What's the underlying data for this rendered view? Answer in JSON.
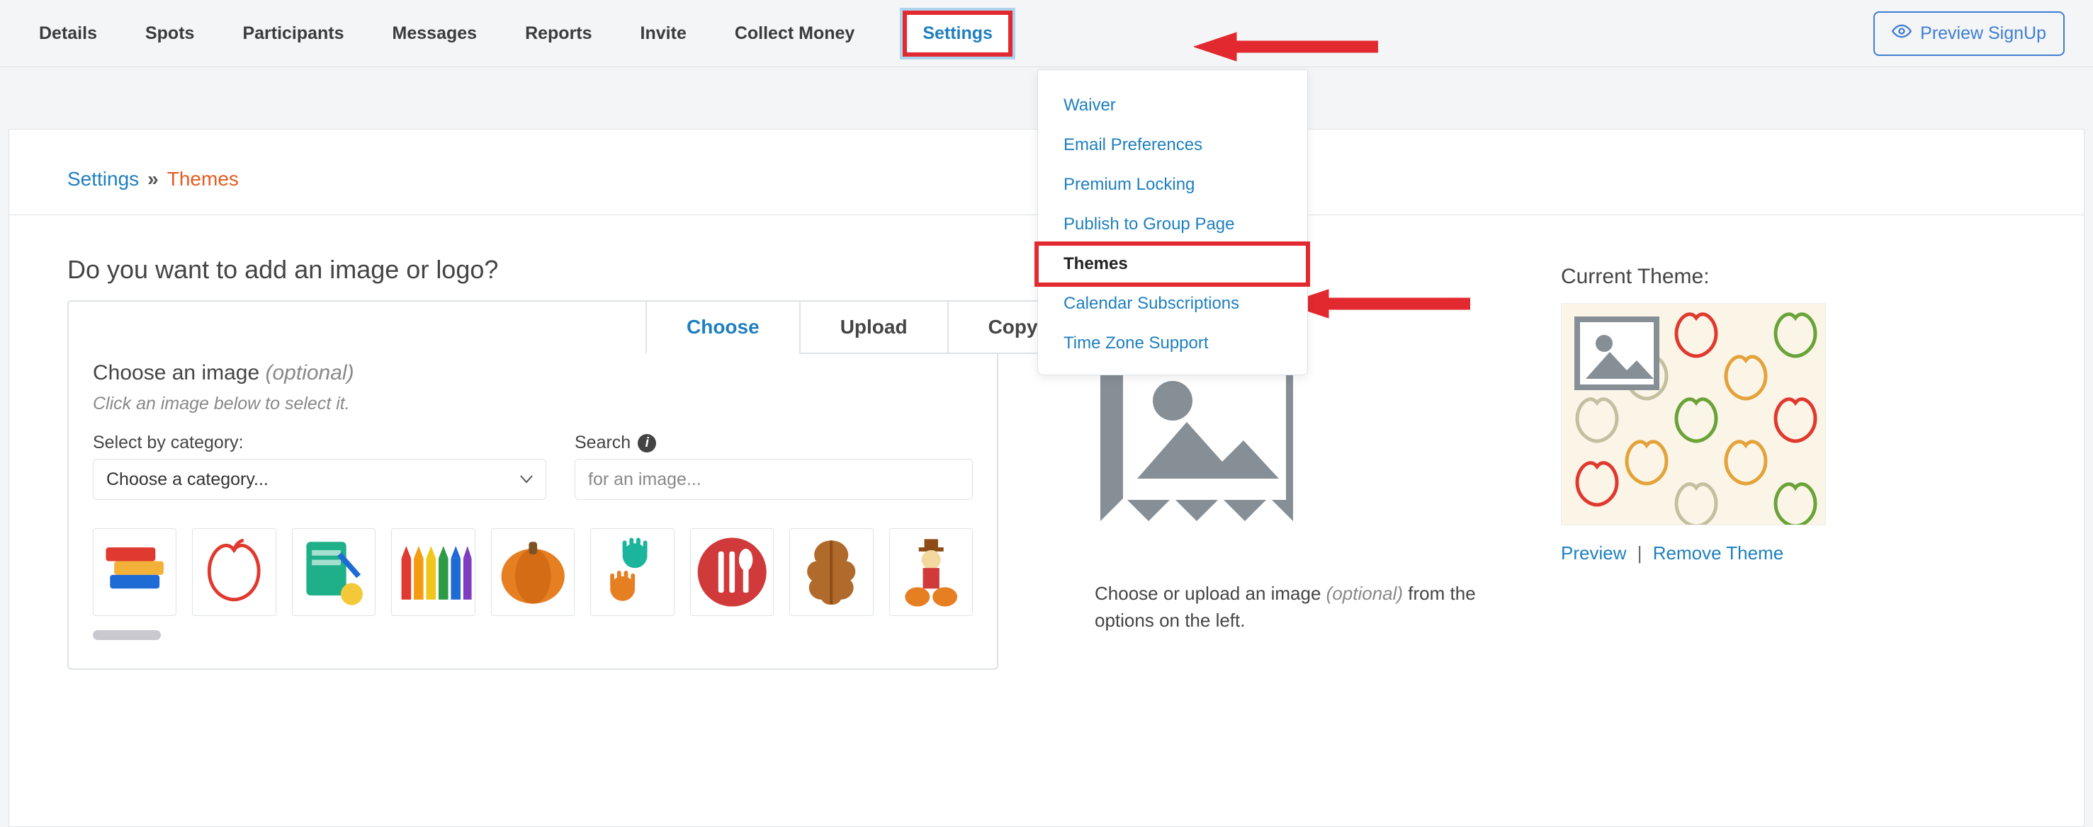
{
  "nav": {
    "tabs": [
      {
        "label": "Details"
      },
      {
        "label": "Spots"
      },
      {
        "label": "Participants"
      },
      {
        "label": "Messages"
      },
      {
        "label": "Reports"
      },
      {
        "label": "Invite"
      },
      {
        "label": "Collect Money"
      },
      {
        "label": "Settings"
      }
    ],
    "preview_button": "Preview SignUp"
  },
  "settings_menu": [
    {
      "label": "Waiver"
    },
    {
      "label": "Email Preferences"
    },
    {
      "label": "Premium Locking"
    },
    {
      "label": "Publish to Group Page"
    },
    {
      "label": "Themes"
    },
    {
      "label": "Calendar Subscriptions"
    },
    {
      "label": "Time Zone Support"
    }
  ],
  "breadcrumb": {
    "settings": "Settings",
    "sep": "»",
    "themes": "Themes"
  },
  "left": {
    "heading": "Do you want to add an image or logo?",
    "tabs": {
      "choose": "Choose",
      "upload": "Upload",
      "copy": "Copy"
    },
    "choose_heading": "Choose an image",
    "optional": "(optional)",
    "instruction": "Click an image below to select it.",
    "select_label": "Select by category:",
    "select_placeholder": "Choose a category...",
    "search_label": "Search",
    "search_placeholder": "for an image...",
    "thumbs": [
      {
        "name": "books"
      },
      {
        "name": "apple-outline"
      },
      {
        "name": "notebook-ideas"
      },
      {
        "name": "crayons"
      },
      {
        "name": "pumpkin"
      },
      {
        "name": "handprints"
      },
      {
        "name": "cutlery"
      },
      {
        "name": "oak-leaf"
      },
      {
        "name": "scarecrow"
      }
    ]
  },
  "mid": {
    "text_a": "Choose or upload an image ",
    "optional": "(optional)",
    "text_b": " from the options on the left."
  },
  "right": {
    "heading": "Current Theme:",
    "preview": "Preview",
    "sep": "|",
    "remove": "Remove Theme"
  }
}
